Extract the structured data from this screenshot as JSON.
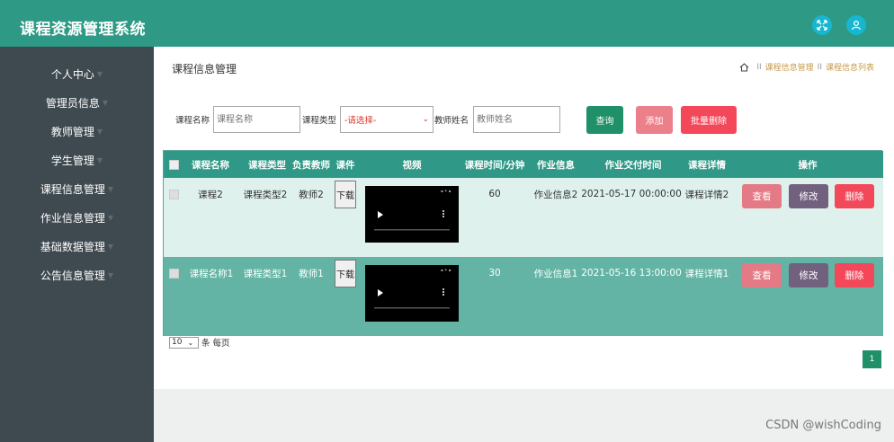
{
  "app": {
    "title": "课程资源管理系统"
  },
  "header": {
    "icons": [
      "expand-icon",
      "user-icon"
    ],
    "accent": "#2e9985"
  },
  "sidebar": {
    "items": [
      {
        "label": "个人中心"
      },
      {
        "label": "管理员信息"
      },
      {
        "label": "教师管理"
      },
      {
        "label": "学生管理"
      },
      {
        "label": "课程信息管理"
      },
      {
        "label": "作业信息管理"
      },
      {
        "label": "基础数据管理"
      },
      {
        "label": "公告信息管理"
      }
    ]
  },
  "page": {
    "title": "课程信息管理",
    "breadcrumb": [
      "课程信息管理",
      "课程信息列表"
    ]
  },
  "filters": {
    "course_name_label": "课程名称",
    "course_name_placeholder": "课程名称",
    "course_type_label": "课程类型",
    "course_type_value": "-请选择-",
    "teacher_name_label": "教师姓名",
    "teacher_name_placeholder": "教师姓名"
  },
  "actions": {
    "search": "查询",
    "add": "添加",
    "batch_delete": "批量删除"
  },
  "table": {
    "columns": [
      "课程名称",
      "课程类型",
      "负责教师",
      "课件",
      "视频",
      "课程时间/分钟",
      "作业信息",
      "作业交付时间",
      "课程详情",
      "操作"
    ],
    "rows": [
      {
        "name": "课程2",
        "type": "课程类型2",
        "teacher": "教师2",
        "courseware": "下载",
        "minutes": "60",
        "homework": "作业信息2",
        "deadline": "2021-05-17 00:00:00",
        "detail": "课程详情2",
        "view": "查看",
        "edit": "修改",
        "delete": "删除"
      },
      {
        "name": "课程名称1",
        "type": "课程类型1",
        "teacher": "教师1",
        "courseware": "下载",
        "minutes": "30",
        "homework": "作业信息1",
        "deadline": "2021-05-16 13:00:00",
        "detail": "课程详情1",
        "view": "查看",
        "edit": "修改",
        "delete": "删除"
      }
    ]
  },
  "pagination": {
    "page_size": "10",
    "page_size_suffix": "条 每页",
    "current_page": "1"
  },
  "watermark": "CSDN @wishCoding",
  "colors": {
    "header": "#2e9985",
    "sidebar": "#3f4a50",
    "view_btn": "#e47a85",
    "edit_btn": "#72607f",
    "delete_btn": "#f2485a",
    "search_btn": "#1f9067"
  }
}
